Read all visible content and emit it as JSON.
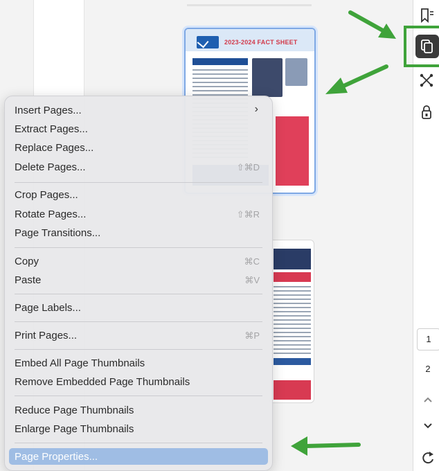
{
  "thumbnails": {
    "page1_title": "2023-2024 FACT SHEET"
  },
  "context_menu": {
    "items": [
      {
        "label": "Insert Pages...",
        "shortcut": "",
        "submenu": true
      },
      {
        "label": "Extract Pages...",
        "shortcut": ""
      },
      {
        "label": "Replace Pages...",
        "shortcut": ""
      },
      {
        "label": "Delete Pages...",
        "shortcut": "⇧⌘D"
      },
      {
        "label": "Crop Pages...",
        "shortcut": ""
      },
      {
        "label": "Rotate Pages...",
        "shortcut": "⇧⌘R"
      },
      {
        "label": "Page Transitions...",
        "shortcut": ""
      },
      {
        "label": "Copy",
        "shortcut": "⌘C"
      },
      {
        "label": "Paste",
        "shortcut": "⌘V"
      },
      {
        "label": "Page Labels...",
        "shortcut": ""
      },
      {
        "label": "Print Pages...",
        "shortcut": "⌘P"
      },
      {
        "label": "Embed All Page Thumbnails",
        "shortcut": ""
      },
      {
        "label": "Remove Embedded Page Thumbnails",
        "shortcut": ""
      },
      {
        "label": "Reduce Page Thumbnails",
        "shortcut": ""
      },
      {
        "label": "Enlarge Page Thumbnails",
        "shortcut": ""
      },
      {
        "label": "Page Properties...",
        "shortcut": "",
        "highlighted": true
      }
    ],
    "submenu_arrow": "›"
  },
  "right_toolbar": {
    "icons": [
      "bookmarks-icon",
      "page-thumbnails-icon",
      "structure-icon",
      "security-icon"
    ],
    "selected": "page-thumbnails-icon"
  },
  "page_navigation": {
    "pages": [
      "1",
      "2"
    ],
    "current": "1"
  },
  "colors": {
    "annotation_green": "#3fa33a",
    "menu_highlight": "#9fbde4"
  }
}
